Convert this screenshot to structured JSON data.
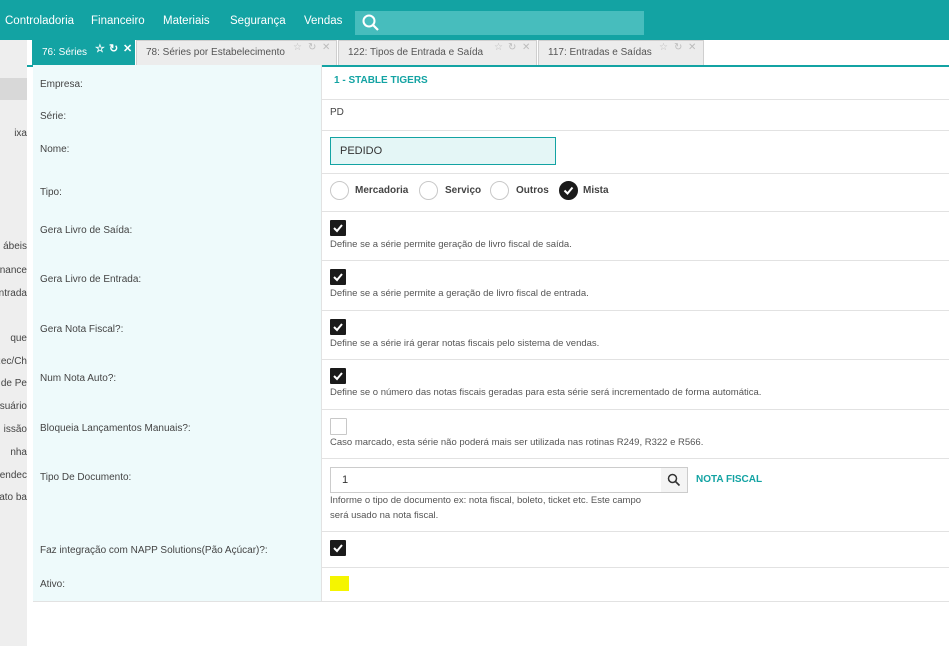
{
  "topbar": {
    "menu": [
      "Controladoria",
      "Financeiro",
      "Materiais",
      "Segurança",
      "Vendas"
    ],
    "search_placeholder": ""
  },
  "sidebar": {
    "items": [
      "ixa",
      "ábeis",
      "nance",
      "ntrada",
      "que",
      "Rec/Ch",
      "de Pe",
      "suário",
      "issão",
      "nha",
      "endec",
      "ato ba"
    ]
  },
  "tabs": [
    {
      "label": "76: Séries",
      "active": true
    },
    {
      "label": "78: Séries por Estabelecimento",
      "active": false
    },
    {
      "label": "122: Tipos de Entrada e Saída",
      "active": false
    },
    {
      "label": "117: Entradas e Saídas",
      "active": false
    }
  ],
  "form": {
    "empresa_label": "Empresa:",
    "empresa_value": "1 - STABLE TIGERS",
    "serie_label": "Série:",
    "serie_value": "PD",
    "nome_label": "Nome:",
    "nome_value": "PEDIDO",
    "tipo_label": "Tipo:",
    "tipo_options": [
      "Mercadoria",
      "Serviço",
      "Outros",
      "Mista"
    ],
    "tipo_selected": "Mista",
    "gera_saida_label": "Gera Livro de Saída:",
    "gera_saida_checked": true,
    "gera_saida_desc": "Define se a série permite geração de livro fiscal de saída.",
    "gera_entrada_label": "Gera Livro de Entrada:",
    "gera_entrada_checked": true,
    "gera_entrada_desc": "Define se a série permite a geração de livro fiscal de entrada.",
    "gera_nota_label": "Gera Nota Fiscal?:",
    "gera_nota_checked": true,
    "gera_nota_desc": "Define se a série irá gerar notas fiscais pelo sistema de vendas.",
    "num_nota_label": "Num Nota Auto?:",
    "num_nota_checked": true,
    "num_nota_desc": "Define se o número das notas fiscais geradas para esta série será incrementado de forma automática.",
    "bloqueia_label": "Bloqueia Lançamentos Manuais?:",
    "bloqueia_checked": false,
    "bloqueia_desc": "Caso marcado, esta série não poderá mais ser utilizada nas rotinas R249, R322 e R566.",
    "tipo_doc_label": "Tipo De Documento:",
    "tipo_doc_value": "1",
    "tipo_doc_name": "NOTA FISCAL",
    "tipo_doc_desc_1": "Informe o tipo de documento ex: nota fiscal, boleto, ticket etc. Este campo",
    "tipo_doc_desc_2": "será usado na nota fiscal.",
    "napp_label": "Faz integração com NAPP Solutions(Pão Açúcar)?:",
    "napp_checked": true,
    "ativo_label": "Ativo:",
    "ativo_highlight_color": "#f5f500"
  },
  "colors": {
    "accent": "#13a3a3",
    "label_bg": "#eefafb"
  }
}
